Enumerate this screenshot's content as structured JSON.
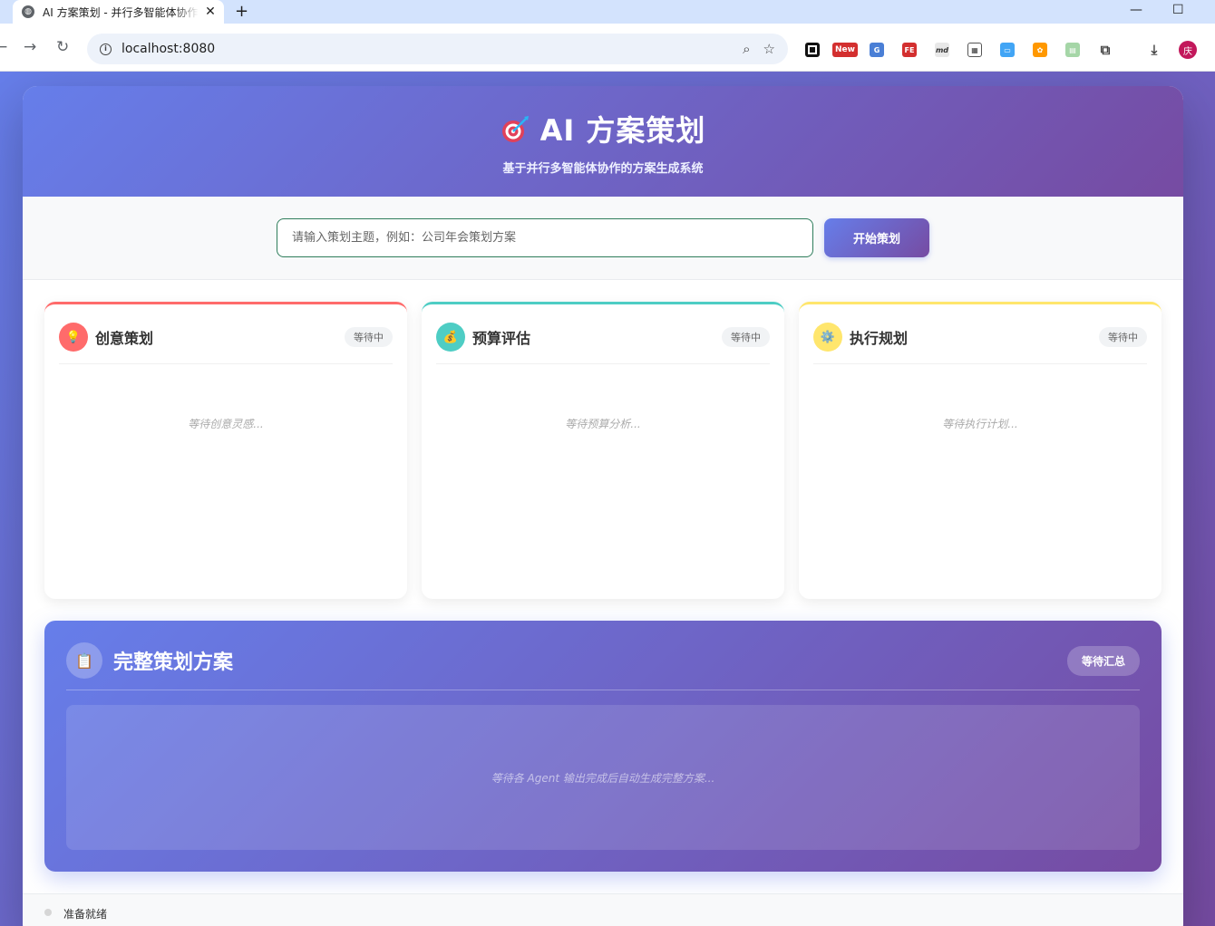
{
  "browser": {
    "tab_title": "AI 方案策划 - 并行多智能体协作",
    "tab_close": "✕",
    "new_tab": "+",
    "url": "localhost:8080",
    "avatar_letter": "庆",
    "extension_badge_new": "New",
    "extension_fe": "FE",
    "extension_md": "md"
  },
  "header": {
    "title": "AI 方案策划",
    "subtitle": "基于并行多智能体协作的方案生成系统"
  },
  "input": {
    "placeholder": "请输入策划主题，例如：公司年会策划方案",
    "button_label": "开始策划"
  },
  "agents": [
    {
      "title": "创意策划",
      "status": "等待中",
      "placeholder": "等待创意灵感...",
      "icon": "lightbulb-icon",
      "color": "#ff6b6b"
    },
    {
      "title": "预算评估",
      "status": "等待中",
      "placeholder": "等待预算分析...",
      "icon": "money-bag-icon",
      "color": "#4ecdc4"
    },
    {
      "title": "执行规划",
      "status": "等待中",
      "placeholder": "等待执行计划...",
      "icon": "gear-icon",
      "color": "#ffe66d"
    }
  ],
  "final": {
    "title": "完整策划方案",
    "status": "等待汇总",
    "placeholder": "等待各 Agent 输出完成后自动生成完整方案...",
    "icon": "clipboard-icon"
  },
  "status_bar": {
    "text": "准备就绪"
  },
  "colors": {
    "gradient_start": "#667eea",
    "gradient_end": "#764ba2"
  }
}
